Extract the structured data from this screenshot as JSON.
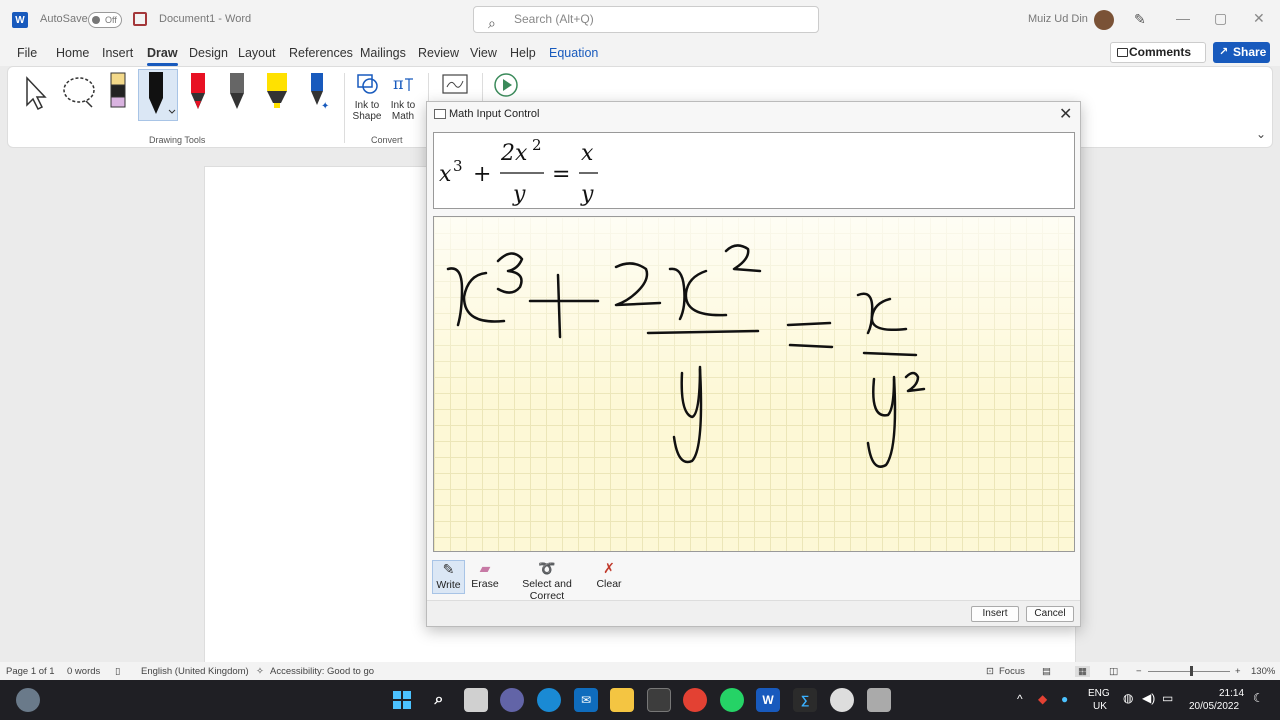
{
  "app": {
    "autosave_label": "AutoSave",
    "autosave_state": "Off",
    "doc_title": "Document1  -  Word",
    "search_placeholder": "Search (Alt+Q)",
    "user_name": "Muiz Ud Din"
  },
  "menu": {
    "items": [
      "File",
      "Home",
      "Insert",
      "Draw",
      "Design",
      "Layout",
      "References",
      "Mailings",
      "Review",
      "View",
      "Help",
      "Equation"
    ],
    "active": "Draw",
    "comments_label": "Comments",
    "share_label": "Share"
  },
  "ribbon": {
    "drawing_tools_label": "Drawing Tools",
    "convert_label": "Convert",
    "ink_to_shape": [
      "Ink to",
      "Shape"
    ],
    "ink_to_math": [
      "Ink to",
      "Math"
    ],
    "pen_colors": [
      "#000000",
      "#e81123",
      "#666666",
      "#ffe100",
      "#185abd"
    ]
  },
  "status": {
    "page": "Page 1 of 1",
    "words": "0 words",
    "language": "English (United Kingdom)",
    "accessibility": "Accessibility: Good to go",
    "focus": "Focus",
    "zoom": "130%"
  },
  "taskbar": {
    "lang_top": "ENG",
    "lang_bottom": "UK",
    "time": "21:14",
    "date": "20/05/2022"
  },
  "dialog": {
    "title": "Math Input Control",
    "tools": [
      "Write",
      "Erase",
      "Select and Correct",
      "Clear"
    ],
    "selected_tool": "Write",
    "insert_label": "Insert",
    "cancel_label": "Cancel",
    "preview": {
      "base": "x",
      "exp": "3",
      "plus": "+",
      "num": "2x",
      "num_exp": "2",
      "den": "y",
      "equals": "=",
      "rhs_num": "x",
      "rhs_den": "y"
    }
  }
}
